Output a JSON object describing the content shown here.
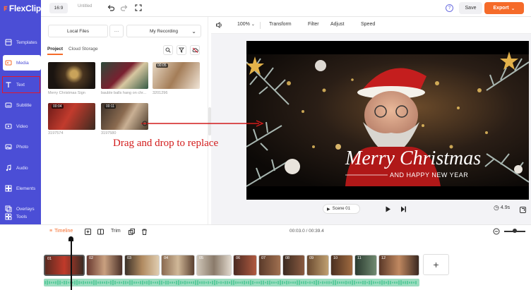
{
  "app": {
    "logo_text": "FlexClip"
  },
  "sidebar": {
    "items": [
      {
        "label": "Templates",
        "icon": "templates-icon"
      },
      {
        "label": "Media",
        "icon": "media-icon"
      },
      {
        "label": "Text",
        "icon": "text-icon"
      },
      {
        "label": "Subtitle",
        "icon": "subtitle-icon"
      },
      {
        "label": "Video",
        "icon": "video-icon"
      },
      {
        "label": "Photo",
        "icon": "photo-icon"
      },
      {
        "label": "Audio",
        "icon": "audio-icon"
      },
      {
        "label": "Elements",
        "icon": "elements-icon"
      },
      {
        "label": "Overlays",
        "icon": "overlays-icon"
      },
      {
        "label": "Tools",
        "icon": "tools-icon"
      }
    ]
  },
  "topbar": {
    "ratio": "16:9",
    "project_title": "Untitled",
    "help": "?",
    "save_label": "Save",
    "export_label": "Export"
  },
  "media_panel": {
    "local_files": "Local Files",
    "more": "···",
    "my_recording": "My Recording",
    "tabs": [
      "Project",
      "Cloud Storage"
    ],
    "items": [
      {
        "label": "Merry Christmas Sign",
        "duration": ""
      },
      {
        "label": "bauble balls hang on chr...",
        "duration": ""
      },
      {
        "label": "3201296",
        "duration": "00:05"
      },
      {
        "label": "3197574",
        "duration": "00:04"
      },
      {
        "label": "3197580",
        "duration": "00:11"
      }
    ]
  },
  "toolbar": {
    "zoom": "100%",
    "transform": "Transform",
    "filter": "Filter",
    "adjust": "Adjust",
    "speed": "Speed"
  },
  "preview": {
    "title_line1": "Merry Christmas",
    "title_line2": "AND HAPPY NEW YEAR",
    "scene": "Scene 01",
    "scene_duration": "4.9s"
  },
  "annotation": {
    "text": "Drag and drop to replace"
  },
  "timeline": {
    "label": "Timeline",
    "trim": "Trim",
    "timecode": "00:03.0 / 00:39.4",
    "clips": [
      "01",
      "02",
      "03",
      "04",
      "05",
      "06",
      "07",
      "08",
      "09",
      "10",
      "11",
      "12"
    ],
    "add": "+"
  },
  "colors": {
    "brand": "#4b4ed6",
    "export": "#f56b2a",
    "annotation": "#d21b1b",
    "audio": "#9cddc0"
  }
}
